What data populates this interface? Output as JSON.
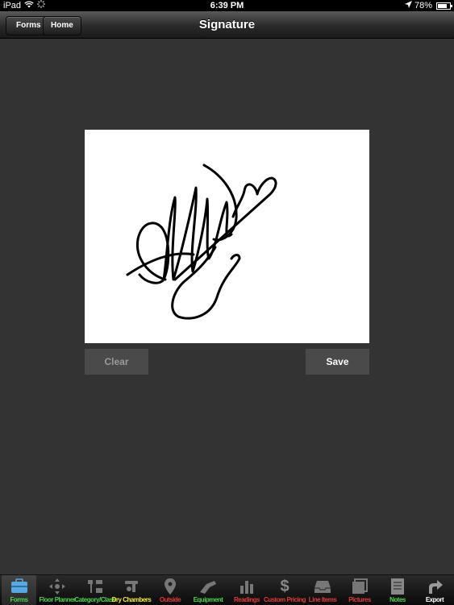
{
  "status_bar": {
    "device": "iPad",
    "time": "6:39 PM",
    "battery": "78%"
  },
  "nav": {
    "back_label": "Forms",
    "home_label": "Home",
    "title": "Signature"
  },
  "actions": {
    "clear_label": "Clear",
    "save_label": "Save"
  },
  "tab_bar": {
    "tabs": [
      {
        "label": "Forms",
        "icon": "briefcase-icon",
        "color": "#4fd14f",
        "active": true
      },
      {
        "label": "Floor Planner",
        "icon": "move-arrows-icon",
        "color": "#4fd14f"
      },
      {
        "label": "Category/Class",
        "icon": "category-icon",
        "color": "#4fd14f"
      },
      {
        "label": "Dry Chambers",
        "icon": "dry-chamber-icon",
        "color": "#f2ea3a"
      },
      {
        "label": "Outside",
        "icon": "location-pin-icon",
        "color": "#e23b3b"
      },
      {
        "label": "Equipment",
        "icon": "equipment-icon",
        "color": "#4fd14f"
      },
      {
        "label": "Readings",
        "icon": "readings-chart-icon",
        "color": "#e23b3b"
      },
      {
        "label": "Custom Pricing",
        "icon": "dollar-icon",
        "color": "#e23b3b"
      },
      {
        "label": "Line Items",
        "icon": "inbox-tray-icon",
        "color": "#e23b3b"
      },
      {
        "label": "Pictures",
        "icon": "pictures-icon",
        "color": "#e23b3b"
      },
      {
        "label": "Notes",
        "icon": "notes-icon",
        "color": "#4fd14f"
      },
      {
        "label": "Export",
        "icon": "export-arrow-icon",
        "color": "#ffffff"
      }
    ]
  },
  "colors": {
    "background": "#333333",
    "pad": "#ffffff",
    "button_bg": "#4a4a4a"
  }
}
